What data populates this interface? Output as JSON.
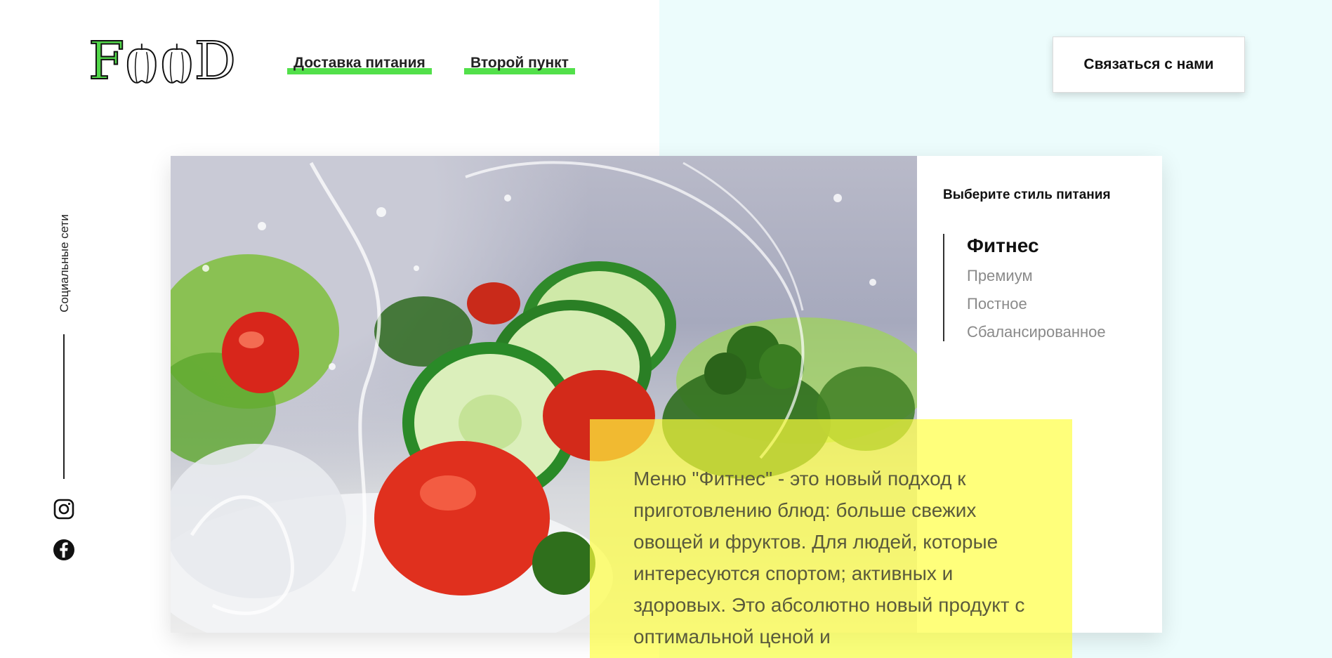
{
  "header": {
    "logo": {
      "first_letter": "F",
      "last_letter": "D"
    },
    "nav": [
      {
        "label": "Доставка питания"
      },
      {
        "label": "Второй пункт"
      }
    ],
    "contact_label": "Связаться с нами"
  },
  "social": {
    "label": "Социальные сети",
    "icons": [
      "instagram-icon",
      "facebook-icon"
    ]
  },
  "selector": {
    "title": "Выберите стиль питания",
    "items": [
      {
        "label": "Фитнес",
        "active": true
      },
      {
        "label": "Премиум",
        "active": false
      },
      {
        "label": "Постное",
        "active": false
      },
      {
        "label": "Сбалансированное",
        "active": false
      }
    ]
  },
  "description": {
    "text": "Меню \"Фитнес\" - это новый подход к приготовлению блюд: больше свежих овощей и фруктов. Для людей, которые интересуются спортом; активных и здоровых. Это абсолютно новый продукт с оптимальной ценой и"
  },
  "colors": {
    "accent_green": "#52e04a",
    "right_background": "#ecfcfc",
    "description_box": "#ffff3c"
  }
}
